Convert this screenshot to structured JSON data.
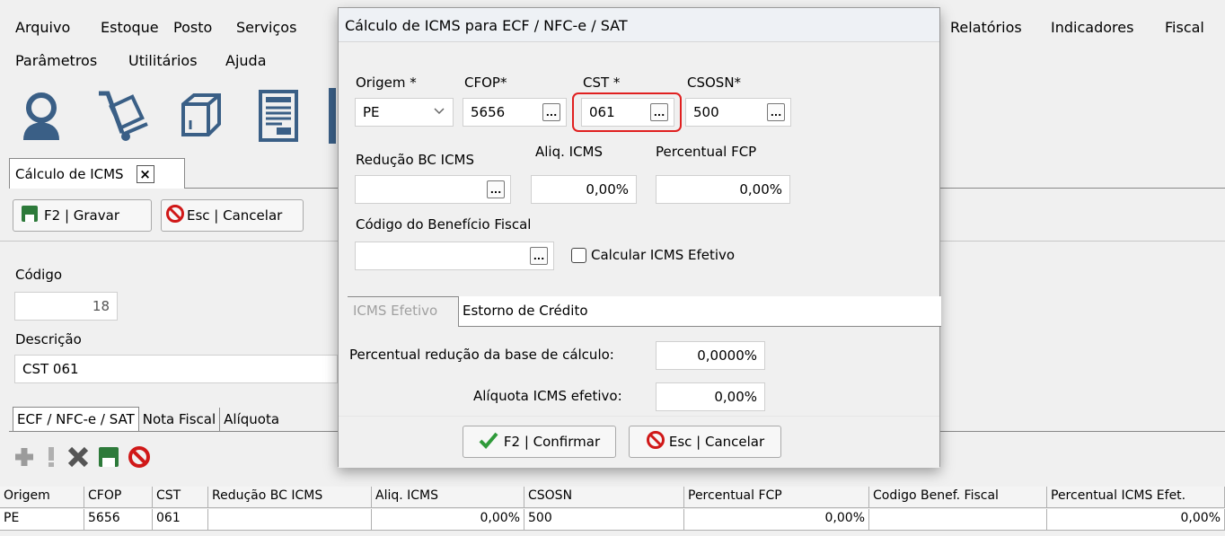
{
  "menu": {
    "row1": [
      "Arquivo",
      "Estoque",
      "Posto",
      "Serviços"
    ],
    "row1_right": [
      "Relatórios",
      "Indicadores",
      "Fiscal"
    ],
    "row2": [
      "Parâmetros",
      "Utilitários",
      "Ajuda"
    ]
  },
  "toolbar": {
    "icons": [
      "user-icon",
      "hand-truck-icon",
      "box-icon",
      "document-icon"
    ]
  },
  "doc_tab": {
    "label": "Cálculo de ICMS",
    "close": "×"
  },
  "actions": {
    "save_label": "F2 | Gravar",
    "cancel_label": "Esc | Cancelar"
  },
  "form": {
    "codigo_label": "Código",
    "codigo_value": "18",
    "descricao_label": "Descrição",
    "descricao_value": "CST 061"
  },
  "subtabs": [
    "ECF / NFC-e / SAT",
    "Nota Fiscal",
    "Alíquota"
  ],
  "grid": {
    "headers": [
      "Origem",
      "CFOP",
      "CST",
      "Redução BC ICMS",
      "Aliq. ICMS",
      "CSOSN",
      "Percentual FCP",
      "Codigo Benef. Fiscal",
      "Percentual ICMS Efet."
    ],
    "row": [
      "PE",
      "5656",
      "061",
      "",
      "0,00%",
      "500",
      "0,00%",
      "",
      "0,00%"
    ]
  },
  "dialog": {
    "title": "Cálculo de ICMS para ECF / NFC-e / SAT",
    "origem_label": "Origem *",
    "origem_value": "PE",
    "cfop_label": "CFOP*",
    "cfop_value": "5656",
    "cst_label": "CST *",
    "cst_value": "061",
    "csosn_label": "CSOSN*",
    "csosn_value": "500",
    "reducao_label": "Redução BC ICMS",
    "reducao_value": "",
    "aliq_label": "Aliq. ICMS",
    "aliq_value": "0,00%",
    "fcp_label": "Percentual FCP",
    "fcp_value": "0,00%",
    "beneficio_label": "Código do Benefício Fiscal",
    "beneficio_value": "",
    "calcular_label": "Calcular ICMS Efetivo",
    "calcular_checked": false,
    "tabs": [
      "ICMS Efetivo",
      "Estorno de Crédito"
    ],
    "perc_reducao_label": "Percentual redução da base de cálculo:",
    "perc_reducao_value": "0,0000%",
    "aliquota_efetivo_label": "Alíquota ICMS efetivo:",
    "aliquota_efetivo_value": "0,00%",
    "confirm_label": "F2 | Confirmar",
    "cancel_label": "Esc | Cancelar",
    "ellipsis": "...",
    "highlight_color": "#e02020"
  }
}
